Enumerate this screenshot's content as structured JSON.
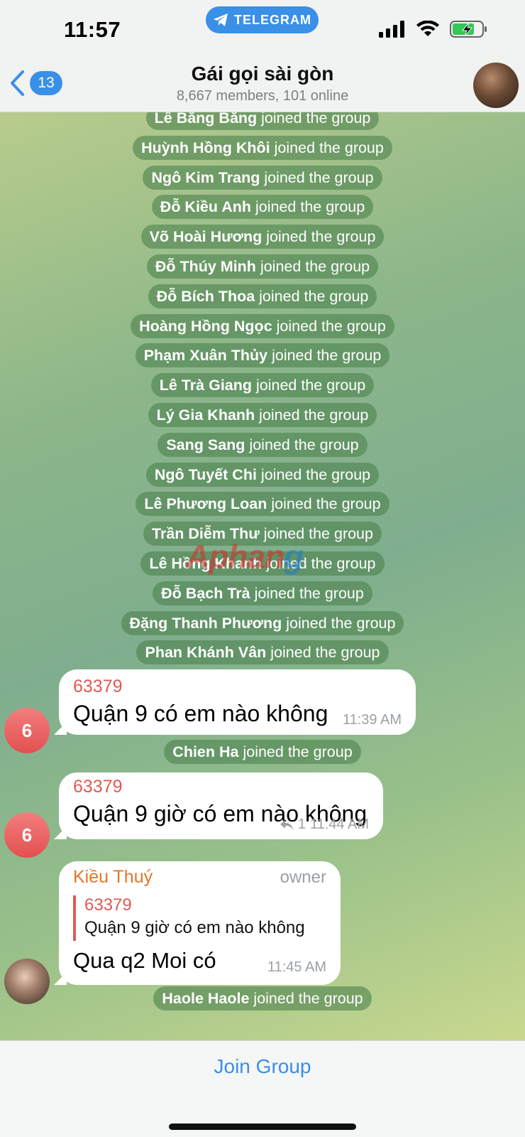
{
  "status": {
    "time": "11:57",
    "app_pill": "TELEGRAM"
  },
  "header": {
    "back_count": "13",
    "title": "Gái gọi sài gòn",
    "subtitle": "8,667 members, 101 online"
  },
  "joined_suffix": "joined the group",
  "joins_top": [
    "Lê Băng Băng",
    "Huỳnh Hồng Khôi",
    "Ngô Kim Trang",
    "Đỗ Kiều Anh",
    "Võ Hoài Hương",
    "Đỗ Thúy Minh",
    "Đỗ Bích Thoa",
    "Hoàng Hồng Ngọc",
    "Phạm Xuân Thủy",
    "Lê Trà Giang",
    "Lý Gia Khanh",
    "Sang Sang",
    "Ngô Tuyết Chi",
    "Lê Phương Loan",
    "Trần Diễm Thư",
    "Lê Hồng Khanh",
    "Đỗ Bạch Trà",
    "Đặng Thanh Phương",
    "Phan Khánh Vân"
  ],
  "messages": [
    {
      "sender": "63379",
      "avatar": "6",
      "text": "Quận 9 có em nào không",
      "time": "11:39 AM"
    },
    {
      "sender": "63379",
      "avatar": "6",
      "text": "Quận 9 giờ có em nào không",
      "reply_count": "1",
      "time": "11:44 AM"
    },
    {
      "sender": "Kiều Thuý",
      "role": "owner",
      "reply_to": {
        "sender": "63379",
        "text": "Quận 9 giờ có em nào không"
      },
      "text": "Qua q2 Moi có",
      "time": "11:45 AM"
    }
  ],
  "join_between": "Chien Ha",
  "join_last": "Haole Haole",
  "watermark": {
    "part1": "Aphan",
    "part2": "g"
  },
  "bottom": {
    "join_button": "Join Group"
  }
}
